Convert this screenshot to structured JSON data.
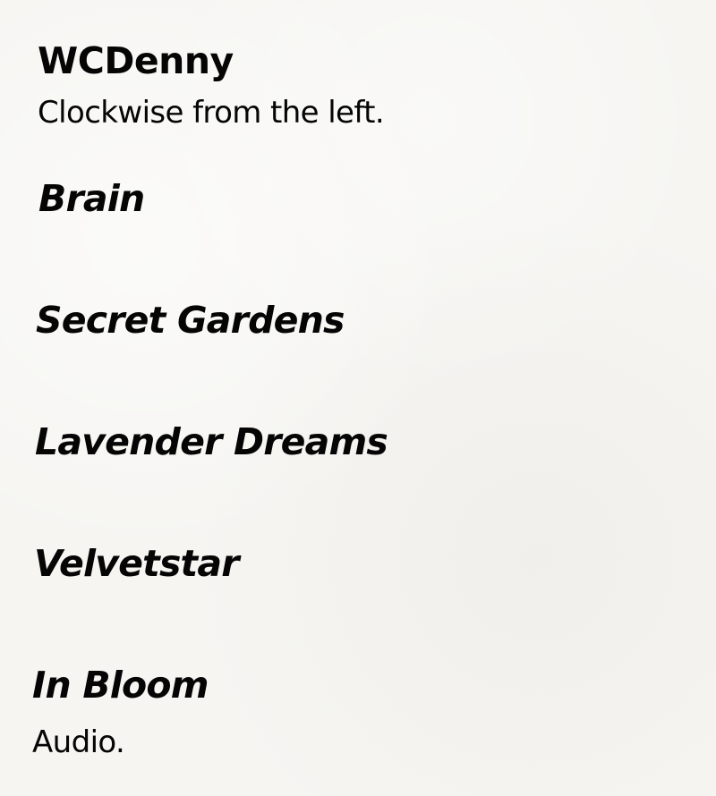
{
  "author": "WCDenny",
  "subtitle": "Clockwise from the left.",
  "titles": [
    "Brain",
    "Secret Gardens",
    "Lavender Dreams",
    "Velvetstar",
    "In Bloom"
  ],
  "footnote": "Audio.",
  "colors": {
    "background": "#f6f5f2",
    "text": "#050505"
  }
}
